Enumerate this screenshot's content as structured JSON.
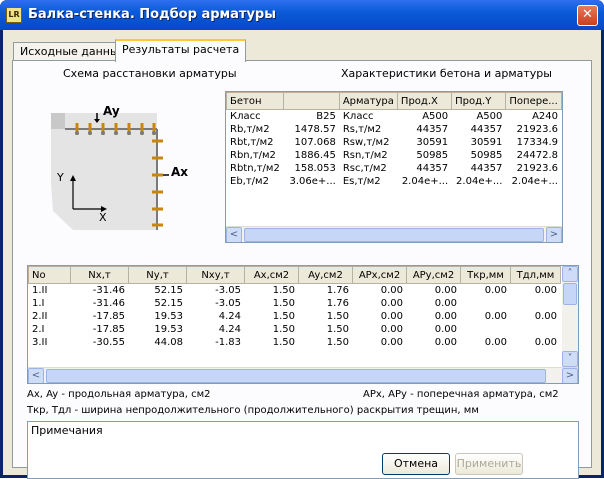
{
  "window": {
    "title": "Балка-стенка. Подбор арматуры",
    "app_icon": "LR",
    "close": "✕"
  },
  "tabs": [
    {
      "label": "Исходные данные"
    },
    {
      "label": "Результаты расчета"
    }
  ],
  "scheme": {
    "caption": "Схема расстановки арматуры",
    "label_ay": "Ay",
    "label_ax": "Ax",
    "axis_y": "Y",
    "axis_x": "X"
  },
  "props": {
    "caption": "Характеристики бетона и арматуры",
    "headers": [
      "Бетон",
      "",
      "Арматура",
      "Прод.X",
      "Прод.Y",
      "Попере..."
    ],
    "rows": [
      [
        "Класс",
        "B25",
        "Класс",
        "A500",
        "A500",
        "A240"
      ],
      [
        "Rb,т/м2",
        "1478.57",
        "Rs,т/м2",
        "44357",
        "44357",
        "21923.6"
      ],
      [
        "Rbt,т/м2",
        "107.068",
        "Rsw,т/м2",
        "30591",
        "30591",
        "17334.9"
      ],
      [
        "Rbn,т/м2",
        "1886.45",
        "Rsn,т/м2",
        "50985",
        "50985",
        "24472.8"
      ],
      [
        "Rbtn,т/м2",
        "158.053",
        "Rsc,т/м2",
        "44357",
        "44357",
        "21923.6"
      ],
      [
        "Eb,т/м2",
        "3.06e+...",
        "Es,т/м2",
        "2.04e+...",
        "2.04e+...",
        "2.04e+..."
      ]
    ]
  },
  "results": {
    "headers": [
      "No",
      "Nx,т",
      "Ny,т",
      "Nxy,т",
      "Ax,см2",
      "Ay,см2",
      "APx,см2",
      "APy,см2",
      "Ткр,мм",
      "Тдл,мм"
    ],
    "rows": [
      [
        "1.II",
        "-31.46",
        "52.15",
        "-3.05",
        "1.50",
        "1.76",
        "0.00",
        "0.00",
        "0.00",
        "0.00"
      ],
      [
        "1.I",
        "-31.46",
        "52.15",
        "-3.05",
        "1.50",
        "1.76",
        "0.00",
        "0.00",
        "",
        ""
      ],
      [
        "2.II",
        "-17.85",
        "19.53",
        "4.24",
        "1.50",
        "1.50",
        "0.00",
        "0.00",
        "0.00",
        "0.00"
      ],
      [
        "2.I",
        "-17.85",
        "19.53",
        "4.24",
        "1.50",
        "1.50",
        "0.00",
        "0.00",
        "",
        ""
      ],
      [
        "3.II",
        "-30.55",
        "44.08",
        "-1.83",
        "1.50",
        "1.50",
        "0.00",
        "0.00",
        "0.00",
        "0.00"
      ]
    ]
  },
  "legend": {
    "left": "Ax, Ay - продольная арматура, см2",
    "right": "APx, APy - поперечная арматура, см2",
    "crack": "Ткр, Тдл - ширина непродолжительного (продолжительного) раскрытия трещин, мм"
  },
  "notes": {
    "label": "Примечания"
  },
  "buttons": {
    "cancel": "Отмена",
    "apply": "Применить"
  },
  "scroll": {
    "left": "<",
    "right": ">",
    "up": "˄",
    "down": "˅"
  },
  "colors": {
    "title_bar": "#0a5bd8",
    "dialog_bg": "#ece9d8",
    "accent_tab": "#ffc83c"
  }
}
